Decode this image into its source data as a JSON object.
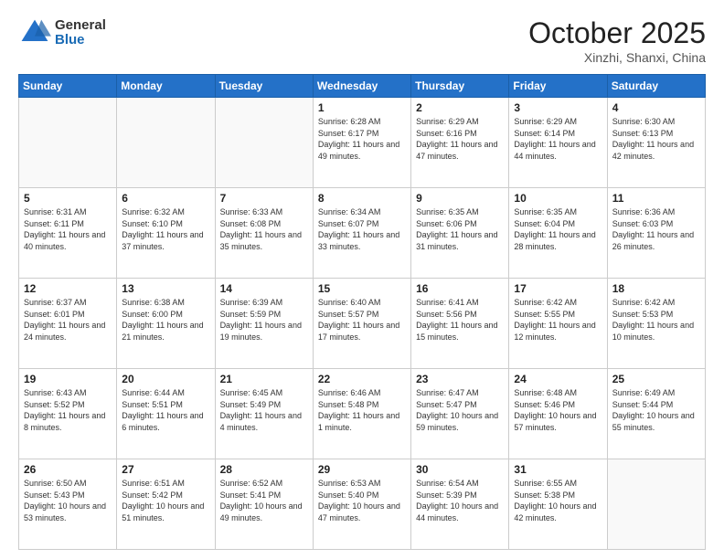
{
  "header": {
    "logo_general": "General",
    "logo_blue": "Blue",
    "month_title": "October 2025",
    "location": "Xinzhi, Shanxi, China"
  },
  "weekdays": [
    "Sunday",
    "Monday",
    "Tuesday",
    "Wednesday",
    "Thursday",
    "Friday",
    "Saturday"
  ],
  "weeks": [
    [
      {
        "day": "",
        "info": ""
      },
      {
        "day": "",
        "info": ""
      },
      {
        "day": "",
        "info": ""
      },
      {
        "day": "1",
        "info": "Sunrise: 6:28 AM\nSunset: 6:17 PM\nDaylight: 11 hours and 49 minutes."
      },
      {
        "day": "2",
        "info": "Sunrise: 6:29 AM\nSunset: 6:16 PM\nDaylight: 11 hours and 47 minutes."
      },
      {
        "day": "3",
        "info": "Sunrise: 6:29 AM\nSunset: 6:14 PM\nDaylight: 11 hours and 44 minutes."
      },
      {
        "day": "4",
        "info": "Sunrise: 6:30 AM\nSunset: 6:13 PM\nDaylight: 11 hours and 42 minutes."
      }
    ],
    [
      {
        "day": "5",
        "info": "Sunrise: 6:31 AM\nSunset: 6:11 PM\nDaylight: 11 hours and 40 minutes."
      },
      {
        "day": "6",
        "info": "Sunrise: 6:32 AM\nSunset: 6:10 PM\nDaylight: 11 hours and 37 minutes."
      },
      {
        "day": "7",
        "info": "Sunrise: 6:33 AM\nSunset: 6:08 PM\nDaylight: 11 hours and 35 minutes."
      },
      {
        "day": "8",
        "info": "Sunrise: 6:34 AM\nSunset: 6:07 PM\nDaylight: 11 hours and 33 minutes."
      },
      {
        "day": "9",
        "info": "Sunrise: 6:35 AM\nSunset: 6:06 PM\nDaylight: 11 hours and 31 minutes."
      },
      {
        "day": "10",
        "info": "Sunrise: 6:35 AM\nSunset: 6:04 PM\nDaylight: 11 hours and 28 minutes."
      },
      {
        "day": "11",
        "info": "Sunrise: 6:36 AM\nSunset: 6:03 PM\nDaylight: 11 hours and 26 minutes."
      }
    ],
    [
      {
        "day": "12",
        "info": "Sunrise: 6:37 AM\nSunset: 6:01 PM\nDaylight: 11 hours and 24 minutes."
      },
      {
        "day": "13",
        "info": "Sunrise: 6:38 AM\nSunset: 6:00 PM\nDaylight: 11 hours and 21 minutes."
      },
      {
        "day": "14",
        "info": "Sunrise: 6:39 AM\nSunset: 5:59 PM\nDaylight: 11 hours and 19 minutes."
      },
      {
        "day": "15",
        "info": "Sunrise: 6:40 AM\nSunset: 5:57 PM\nDaylight: 11 hours and 17 minutes."
      },
      {
        "day": "16",
        "info": "Sunrise: 6:41 AM\nSunset: 5:56 PM\nDaylight: 11 hours and 15 minutes."
      },
      {
        "day": "17",
        "info": "Sunrise: 6:42 AM\nSunset: 5:55 PM\nDaylight: 11 hours and 12 minutes."
      },
      {
        "day": "18",
        "info": "Sunrise: 6:42 AM\nSunset: 5:53 PM\nDaylight: 11 hours and 10 minutes."
      }
    ],
    [
      {
        "day": "19",
        "info": "Sunrise: 6:43 AM\nSunset: 5:52 PM\nDaylight: 11 hours and 8 minutes."
      },
      {
        "day": "20",
        "info": "Sunrise: 6:44 AM\nSunset: 5:51 PM\nDaylight: 11 hours and 6 minutes."
      },
      {
        "day": "21",
        "info": "Sunrise: 6:45 AM\nSunset: 5:49 PM\nDaylight: 11 hours and 4 minutes."
      },
      {
        "day": "22",
        "info": "Sunrise: 6:46 AM\nSunset: 5:48 PM\nDaylight: 11 hours and 1 minute."
      },
      {
        "day": "23",
        "info": "Sunrise: 6:47 AM\nSunset: 5:47 PM\nDaylight: 10 hours and 59 minutes."
      },
      {
        "day": "24",
        "info": "Sunrise: 6:48 AM\nSunset: 5:46 PM\nDaylight: 10 hours and 57 minutes."
      },
      {
        "day": "25",
        "info": "Sunrise: 6:49 AM\nSunset: 5:44 PM\nDaylight: 10 hours and 55 minutes."
      }
    ],
    [
      {
        "day": "26",
        "info": "Sunrise: 6:50 AM\nSunset: 5:43 PM\nDaylight: 10 hours and 53 minutes."
      },
      {
        "day": "27",
        "info": "Sunrise: 6:51 AM\nSunset: 5:42 PM\nDaylight: 10 hours and 51 minutes."
      },
      {
        "day": "28",
        "info": "Sunrise: 6:52 AM\nSunset: 5:41 PM\nDaylight: 10 hours and 49 minutes."
      },
      {
        "day": "29",
        "info": "Sunrise: 6:53 AM\nSunset: 5:40 PM\nDaylight: 10 hours and 47 minutes."
      },
      {
        "day": "30",
        "info": "Sunrise: 6:54 AM\nSunset: 5:39 PM\nDaylight: 10 hours and 44 minutes."
      },
      {
        "day": "31",
        "info": "Sunrise: 6:55 AM\nSunset: 5:38 PM\nDaylight: 10 hours and 42 minutes."
      },
      {
        "day": "",
        "info": ""
      }
    ]
  ]
}
